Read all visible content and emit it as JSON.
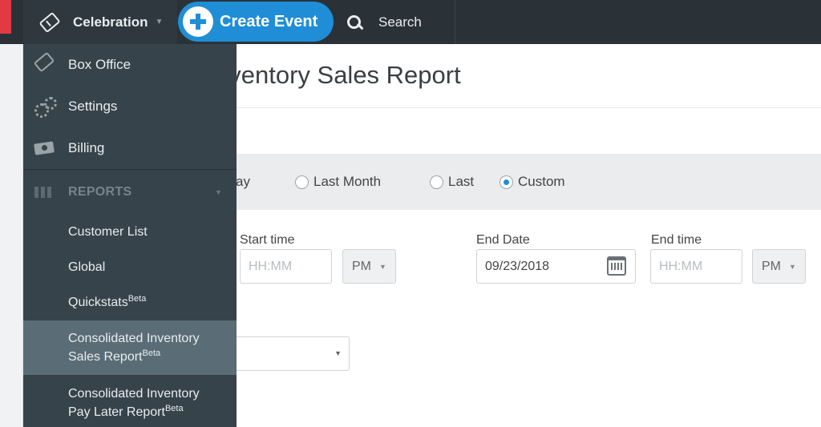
{
  "topbar": {
    "event_name": "Celebration",
    "create_label": "Create Event",
    "search_label": "Search"
  },
  "menu": {
    "items": [
      {
        "label": "Box Office",
        "icon": "ticket-icon"
      },
      {
        "label": "Settings",
        "icon": "gears-icon"
      },
      {
        "label": "Billing",
        "icon": "money-icon"
      }
    ],
    "reports_header": "REPORTS",
    "reports": [
      {
        "line1": "Customer List",
        "line2": "",
        "badge": ""
      },
      {
        "line1": "Global",
        "line2": "",
        "badge": ""
      },
      {
        "line1": "Quickstats",
        "line2": "",
        "badge": "Beta"
      },
      {
        "line1": "Consolidated Inventory",
        "line2": "Sales Report",
        "badge": "Beta",
        "active": true
      },
      {
        "line1": "Consolidated Inventory",
        "line2": "Pay Later Report",
        "badge": "Beta"
      }
    ]
  },
  "page": {
    "title": "nventory Sales Report"
  },
  "range": {
    "partial_label": "ay",
    "options": [
      {
        "label": "Last Month",
        "selected": false
      },
      {
        "label": "Last",
        "selected": false
      },
      {
        "label": "Custom",
        "selected": true
      }
    ]
  },
  "filters": {
    "start_time_label": "Start time",
    "start_time_placeholder": "HH:MM",
    "start_ampm": "PM",
    "end_date_label": "End Date",
    "end_date_value": "09/23/2018",
    "end_time_label": "End time",
    "end_time_placeholder": "HH:MM",
    "end_ampm": "PM"
  },
  "colors": {
    "topbar": "#2a3238",
    "menu": "#37434a",
    "menu_active": "#5a6c76",
    "accent": "#1f8ed6",
    "brand_red": "#e23a44"
  }
}
